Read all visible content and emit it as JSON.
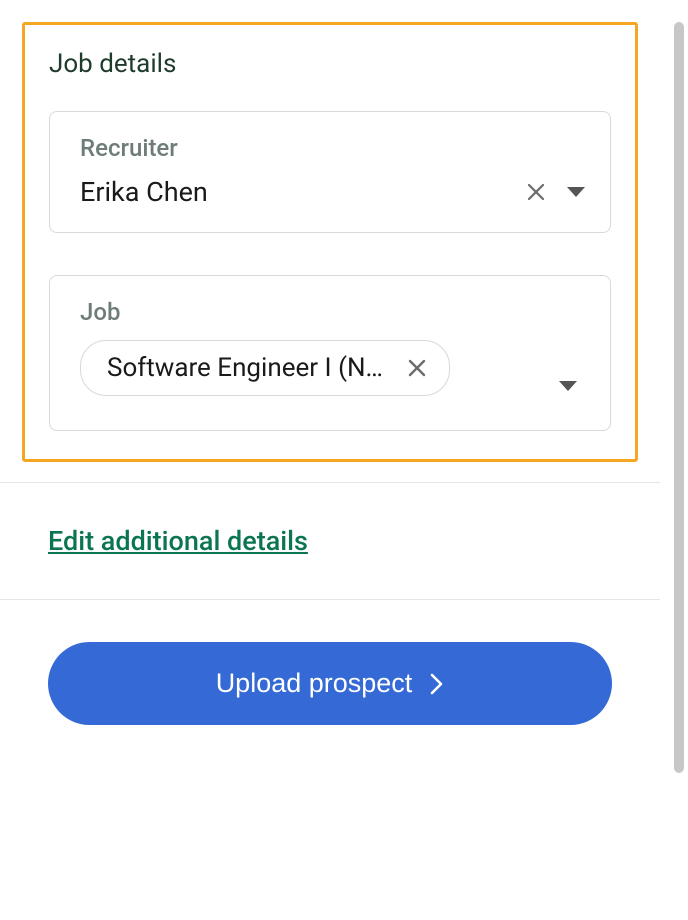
{
  "section": {
    "title": "Job details",
    "recruiter": {
      "label": "Recruiter",
      "value": "Erika Chen"
    },
    "job": {
      "label": "Job",
      "chip_text": "Software Engineer I (N…"
    }
  },
  "edit_link": "Edit additional details",
  "upload_button": "Upload prospect"
}
